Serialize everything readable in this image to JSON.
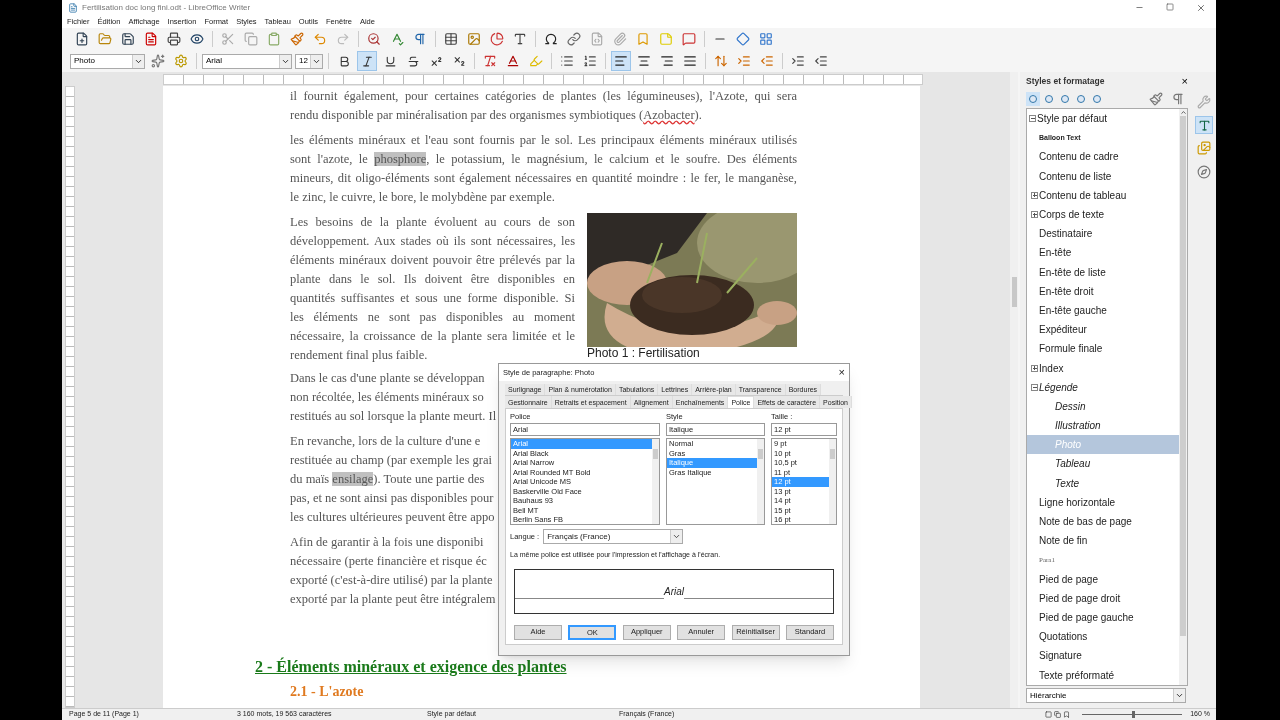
{
  "window": {
    "title": "Fertilisation doc long fini.odt - LibreOffice Writer"
  },
  "menu": [
    "Fichier",
    "Édition",
    "Affichage",
    "Insertion",
    "Format",
    "Styles",
    "Tableau",
    "Outils",
    "Fenêtre",
    "Aide"
  ],
  "toolbar": {
    "paragraph_style": "Photo",
    "font_name": "Arial",
    "font_size": "12",
    "formatting": [
      {
        "kind": "bold",
        "selected": false
      },
      {
        "kind": "italic",
        "selected": true
      },
      {
        "kind": "underline",
        "selected": false
      },
      {
        "kind": "strike",
        "selected": false
      },
      {
        "kind": "superscript",
        "selected": false
      },
      {
        "kind": "subscript",
        "selected": false
      }
    ],
    "alignment": [
      {
        "kind": "left",
        "selected": true
      },
      {
        "kind": "center",
        "selected": false
      },
      {
        "kind": "right",
        "selected": false
      },
      {
        "kind": "justify",
        "selected": false
      }
    ]
  },
  "document": {
    "blocks": [
      {
        "kind": "paragraph",
        "lines": [
          [
            {
              "kind": "plain",
              "text": "il fournit également, pour certaines catégories de plantes (les légumineuses), l'Azote, qui sera"
            }
          ],
          [
            {
              "kind": "plain",
              "text": "rendu disponible par minéralisation par des organismes symbiotiques ("
            },
            {
              "kind": "misspelled",
              "text": "Azobacter"
            },
            {
              "kind": "plain",
              "text": ")."
            }
          ]
        ]
      },
      {
        "kind": "paragraph",
        "lines": [
          [
            {
              "kind": "plain",
              "text": "les éléments minéraux et l'eau sont fournis par le sol. Les principaux éléments minéraux utilisés"
            }
          ],
          [
            {
              "kind": "plain",
              "text": "sont l'azote, le "
            },
            {
              "kind": "shaded",
              "text": "phosphore"
            },
            {
              "kind": "plain",
              "text": ", le potassium, le magnésium, le calcium et le soufre. Des éléments"
            }
          ],
          [
            {
              "kind": "plain",
              "text": "mineurs, dit oligo-éléments sont également nécessaires en quantité moindre : le fer, le manganèse,"
            }
          ],
          [
            {
              "kind": "plain",
              "text": "le zinc, le cuivre, le bore, le molybdène par exemple."
            }
          ]
        ]
      },
      {
        "kind": "figure",
        "caption": "Photo 1 : Fertilisation",
        "lines": [
          [
            {
              "kind": "plain",
              "text": "Les besoins de la plante évoluent au cours de son"
            }
          ],
          [
            {
              "kind": "plain",
              "text": "développement. Aux stades où ils sont nécessaires, les"
            }
          ],
          [
            {
              "kind": "plain",
              "text": "éléments minéraux doivent pouvoir être prélevés par la"
            }
          ],
          [
            {
              "kind": "plain",
              "text": "plante dans le sol. Ils doivent être disponibles en"
            }
          ],
          [
            {
              "kind": "plain",
              "text": "quantités suffisantes et sous une forme disponible. Si"
            }
          ],
          [
            {
              "kind": "plain",
              "text": "les éléments ne sont pas disponibles au moment"
            }
          ],
          [
            {
              "kind": "plain",
              "text": "nécessaire, la croissance de la plante sera limitée et le"
            }
          ],
          [
            {
              "kind": "plain",
              "text": "rendement final plus faible."
            }
          ]
        ]
      },
      {
        "kind": "cut",
        "lines": [
          [
            {
              "kind": "plain",
              "text": "Dans le cas d'une plante se développan"
            }
          ],
          [
            {
              "kind": "plain",
              "text": "non récoltée, les éléments minéraux so"
            }
          ],
          [
            {
              "kind": "plain",
              "text": "restitués au sol lorsque la plante meurt. Il"
            }
          ]
        ]
      },
      {
        "kind": "cut",
        "lines": [
          [
            {
              "kind": "plain",
              "text": "En revanche, lors de la culture d'une e"
            }
          ],
          [
            {
              "kind": "plain",
              "text": "restituée au champ (par exemple les grai"
            }
          ],
          [
            {
              "kind": "plain",
              "text": "du maïs "
            },
            {
              "kind": "shaded",
              "text": "ensilage"
            },
            {
              "kind": "plain",
              "text": "). Toute une partie des"
            }
          ],
          [
            {
              "kind": "plain",
              "text": "pas, et ne sont ainsi pas disponibles pour"
            }
          ],
          [
            {
              "kind": "plain",
              "text": "les cultures ultérieures peuvent être appo"
            }
          ]
        ]
      },
      {
        "kind": "cut",
        "lines": [
          [
            {
              "kind": "plain",
              "text": "Afin de garantir à la fois une disponibi"
            }
          ],
          [
            {
              "kind": "plain",
              "text": "nécessaire (perte financière et risque éc"
            }
          ],
          [
            {
              "kind": "plain",
              "text": "exporté (c'est-à-dire utilisé) par la plante"
            }
          ],
          [
            {
              "kind": "plain",
              "text": "exporté par la plante peut être intégralem"
            }
          ]
        ]
      },
      {
        "kind": "heading",
        "text": "2 - Éléments minéraux et exigence des plantes"
      },
      {
        "kind": "subheading",
        "text": "2.1 - L'azote"
      }
    ]
  },
  "dialog": {
    "title": "Style de paragraphe: Photo",
    "close": "×",
    "tab_rows": [
      [
        {
          "label": "Surlignage",
          "selected": false
        },
        {
          "label": "Plan & numérotation",
          "selected": false
        },
        {
          "label": "Tabulations",
          "selected": false
        },
        {
          "label": "Lettrines",
          "selected": false
        },
        {
          "label": "Arrière-plan",
          "selected": false
        },
        {
          "label": "Transparence",
          "selected": false
        },
        {
          "label": "Bordures",
          "selected": false
        }
      ],
      [
        {
          "label": "Gestionnaire",
          "selected": false
        },
        {
          "label": "Retraits et espacement",
          "selected": false
        },
        {
          "label": "Alignement",
          "selected": false
        },
        {
          "label": "Enchaînements",
          "selected": false
        },
        {
          "label": "Police",
          "selected": true
        },
        {
          "label": "Effets de caractère",
          "selected": false
        },
        {
          "label": "Position",
          "selected": false
        }
      ]
    ],
    "font": {
      "label": "Police",
      "value": "Arial",
      "items": [
        {
          "label": "Arial",
          "selected": true
        },
        {
          "label": "Arial Black",
          "selected": false
        },
        {
          "label": "Arial Narrow",
          "selected": false
        },
        {
          "label": "Arial Rounded MT Bold",
          "selected": false
        },
        {
          "label": "Arial Unicode MS",
          "selected": false
        },
        {
          "label": "Baskerville Old Face",
          "selected": false
        },
        {
          "label": "Bauhaus 93",
          "selected": false
        },
        {
          "label": "Bell MT",
          "selected": false
        },
        {
          "label": "Berlin Sans FB",
          "selected": false
        }
      ]
    },
    "style": {
      "label": "Style",
      "value": "Italique",
      "items": [
        {
          "label": "Normal",
          "selected": false
        },
        {
          "label": "Gras",
          "selected": false
        },
        {
          "label": "Italique",
          "selected": true
        },
        {
          "label": "Gras Italique",
          "selected": false
        }
      ]
    },
    "size": {
      "label": "Taille :",
      "value": "12 pt",
      "items": [
        {
          "label": "9 pt",
          "selected": false
        },
        {
          "label": "10 pt",
          "selected": false
        },
        {
          "label": "10,5 pt",
          "selected": false
        },
        {
          "label": "11 pt",
          "selected": false
        },
        {
          "label": "12 pt",
          "selected": true
        },
        {
          "label": "13 pt",
          "selected": false
        },
        {
          "label": "14 pt",
          "selected": false
        },
        {
          "label": "15 pt",
          "selected": false
        },
        {
          "label": "16 pt",
          "selected": false
        }
      ]
    },
    "language": {
      "label": "Langue :",
      "value": "Français (France)"
    },
    "note": "La même police est utilisée pour l'impression et l'affichage à l'écran.",
    "preview": "Arial",
    "buttons": [
      {
        "label": "Aide",
        "selected": false
      },
      {
        "label": "OK",
        "selected": true
      },
      {
        "label": "Appliquer",
        "selected": false
      },
      {
        "label": "Annuler",
        "selected": false
      },
      {
        "label": "Réinitialiser",
        "selected": false
      },
      {
        "label": "Standard",
        "selected": false
      }
    ]
  },
  "sidebar": {
    "title": "Styles et formatage",
    "close": "×",
    "tree": [
      {
        "label": "Style par défaut",
        "kind": "normal",
        "selected": false,
        "expanded": true,
        "children": [
          {
            "label": "Balloon Text",
            "kind": "tiny",
            "selected": false
          },
          {
            "label": "Contenu de cadre",
            "kind": "normal",
            "selected": false
          },
          {
            "label": "Contenu de liste",
            "kind": "normal",
            "selected": false
          },
          {
            "label": "Contenu de tableau",
            "kind": "normal",
            "selected": false,
            "expanded": false
          },
          {
            "label": "Corps de texte",
            "kind": "normal",
            "selected": false,
            "expanded": false
          },
          {
            "label": "Destinataire",
            "kind": "normal",
            "selected": false
          },
          {
            "label": "En-tête",
            "kind": "normal",
            "selected": false
          },
          {
            "label": "En-tête de liste",
            "kind": "normal",
            "selected": false
          },
          {
            "label": "En-tête droit",
            "kind": "normal",
            "selected": false
          },
          {
            "label": "En-tête gauche",
            "kind": "normal",
            "selected": false
          },
          {
            "label": "Expéditeur",
            "kind": "normal",
            "selected": false
          },
          {
            "label": "Formule finale",
            "kind": "normal",
            "selected": false
          },
          {
            "label": "Index",
            "kind": "normal",
            "selected": false,
            "expanded": false
          },
          {
            "label": "Légende",
            "kind": "italic",
            "selected": false,
            "expanded": true,
            "children": [
              {
                "label": "Dessin",
                "kind": "italic",
                "selected": false
              },
              {
                "label": "Illustration",
                "kind": "italic",
                "selected": false
              },
              {
                "label": "Photo",
                "kind": "italic",
                "selected": true
              },
              {
                "label": "Tableau",
                "kind": "italic",
                "selected": false
              },
              {
                "label": "Texte",
                "kind": "italic",
                "selected": false
              }
            ]
          },
          {
            "label": "Ligne horizontale",
            "kind": "normal",
            "selected": false
          },
          {
            "label": "Note de bas de page",
            "kind": "normal",
            "selected": false
          },
          {
            "label": "Note de fin",
            "kind": "normal",
            "selected": false
          },
          {
            "label": "Para1",
            "kind": "serif",
            "selected": false
          },
          {
            "label": "Pied de page",
            "kind": "normal",
            "selected": false
          },
          {
            "label": "Pied de page droit",
            "kind": "normal",
            "selected": false
          },
          {
            "label": "Pied de page gauche",
            "kind": "normal",
            "selected": false
          },
          {
            "label": "Quotations",
            "kind": "normal",
            "selected": false
          },
          {
            "label": "Signature",
            "kind": "normal",
            "selected": false
          },
          {
            "label": "Texte préformaté",
            "kind": "normal",
            "selected": false
          }
        ]
      }
    ],
    "filter": "Hiérarchie"
  },
  "status_bar": {
    "page": "Page 5 de 11 (Page 1)",
    "words": "3 160 mots, 19 563 caractères",
    "style": "Style par défaut",
    "language": "Français (France)",
    "zoom": {
      "level": 0.5,
      "reading": "160 %"
    }
  }
}
